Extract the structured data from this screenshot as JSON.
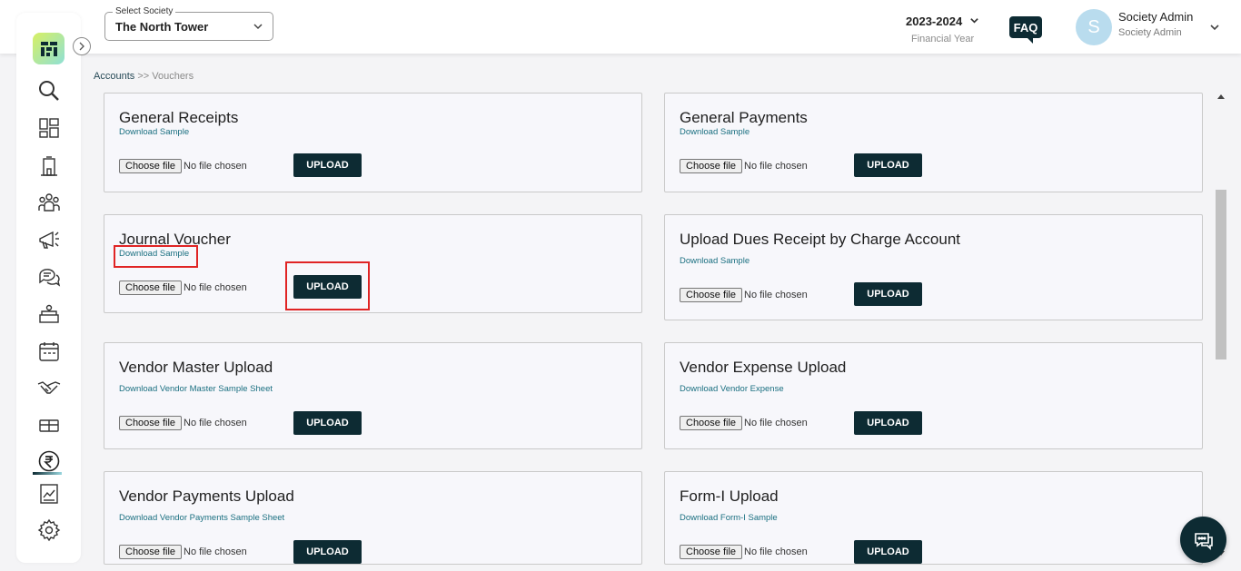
{
  "header": {
    "society_select_legend": "Select Society",
    "society_select_value": "The North Tower",
    "financial_year": "2023-2024",
    "financial_year_label": "Financial Year",
    "faq_label": "FAQ",
    "avatar_initial": "S",
    "user_name": "Society Admin",
    "user_role": "Society Admin"
  },
  "sidebar": {
    "items": [
      "search-icon",
      "dashboard-icon",
      "building-icon",
      "members-icon",
      "announcement-icon",
      "chat-icon",
      "facility-icon",
      "calendar-icon",
      "handshake-icon",
      "parcel-icon",
      "rupee-icon",
      "report-icon",
      "gear-icon"
    ],
    "active_item": "rupee-icon"
  },
  "breadcrumb": {
    "link": "Accounts",
    "separator": ">>",
    "current": "Vouchers"
  },
  "cards": [
    {
      "title": "General Receipts",
      "sample_link": "Download Sample",
      "file_button": "Choose file",
      "file_status": "No file chosen",
      "upload_label": "UPLOAD"
    },
    {
      "title": "General Payments",
      "sample_link": "Download Sample",
      "file_button": "Choose file",
      "file_status": "No file chosen",
      "upload_label": "UPLOAD"
    },
    {
      "title": "Journal Voucher",
      "sample_link": "Download Sample",
      "file_button": "Choose file",
      "file_status": "No file chosen",
      "upload_label": "UPLOAD"
    },
    {
      "title": "Upload Dues Receipt by Charge Account",
      "sample_link": "Download Sample",
      "file_button": "Choose file",
      "file_status": "No file chosen",
      "upload_label": "UPLOAD"
    },
    {
      "title": "Vendor Master Upload",
      "sample_link": "Download Vendor Master Sample Sheet",
      "file_button": "Choose file",
      "file_status": "No file chosen",
      "upload_label": "UPLOAD"
    },
    {
      "title": "Vendor Expense Upload",
      "sample_link": "Download Vendor Expense",
      "file_button": "Choose file",
      "file_status": "No file chosen",
      "upload_label": "UPLOAD"
    },
    {
      "title": "Vendor Payments Upload",
      "sample_link": "Download Vendor Payments Sample Sheet",
      "file_button": "Choose file",
      "file_status": "No file chosen",
      "upload_label": "UPLOAD"
    },
    {
      "title": "Form-I Upload",
      "sample_link": "Download Form-I Sample",
      "file_button": "Choose file",
      "file_status": "No file chosen",
      "upload_label": "UPLOAD"
    }
  ],
  "colors": {
    "primary": "#0d2b33",
    "link": "#1a6f80",
    "highlight": "#e02424",
    "avatar": "#b9dcee"
  }
}
